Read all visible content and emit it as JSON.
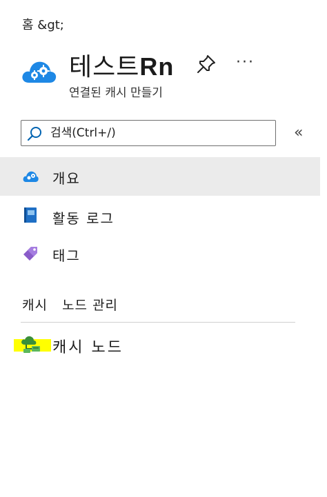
{
  "breadcrumb": {
    "text": "홈 &gt;"
  },
  "header": {
    "title": "테스트",
    "title_suffix": "Rn",
    "subtitle": "연결된 캐시 만들기",
    "more_label": "···"
  },
  "search": {
    "placeholder": "검색(Ctrl+/)",
    "value": ""
  },
  "collapse": {
    "label": "«"
  },
  "nav": {
    "items": [
      {
        "label": "개요",
        "icon": "cloud-gear-icon",
        "selected": true
      },
      {
        "label": "활동 로그",
        "icon": "activity-log-icon",
        "selected": false
      },
      {
        "label": "태그",
        "icon": "tag-icon",
        "selected": false
      }
    ]
  },
  "section": {
    "header": "캐시   노드 관리",
    "items": [
      {
        "label": "캐시 노드",
        "icon": "cache-node-icon"
      }
    ]
  },
  "colors": {
    "accent": "#0078d4",
    "tag": "#8a5cc9",
    "selected_bg": "#ebebeb",
    "highlight": "#ffff00"
  }
}
